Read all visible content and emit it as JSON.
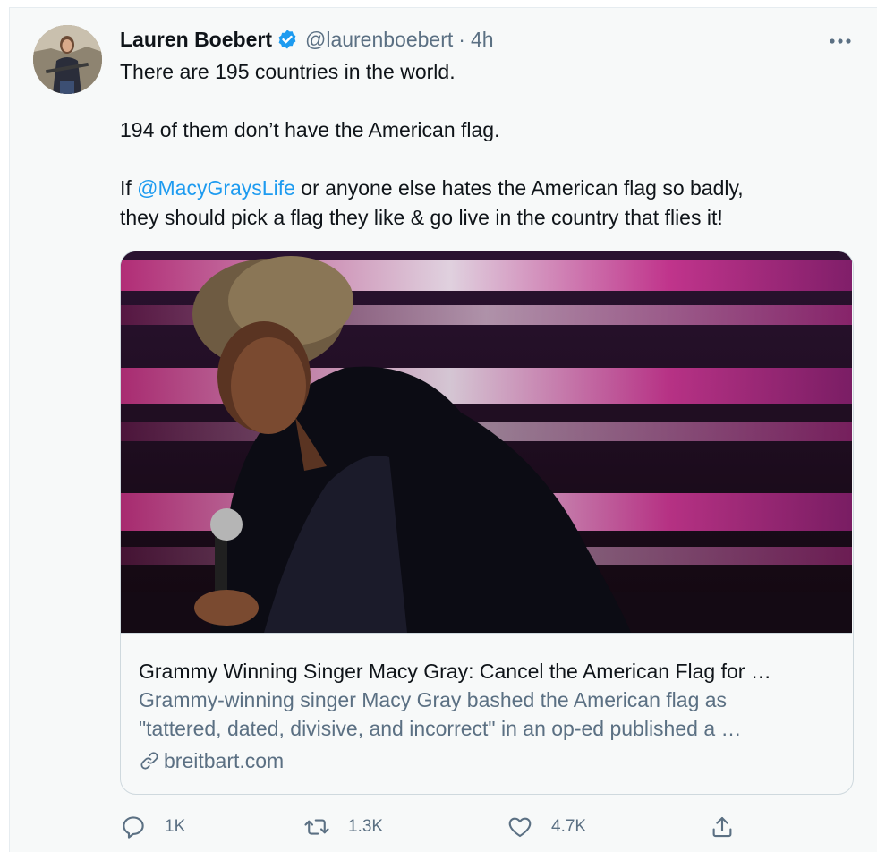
{
  "tweet": {
    "display_name": "Lauren Boebert",
    "handle": "@laurenboebert",
    "separator": "·",
    "time": "4h",
    "lines": [
      {
        "text": "There are 195 countries in the world."
      },
      {
        "text": "194 of them don’t have the American flag."
      },
      {
        "prefix": "If ",
        "mention": "@MacyGraysLife",
        "suffix": " or anyone else hates the American flag so badly,"
      },
      {
        "text": "they should pick a flag they like & go live in the country that flies it!"
      }
    ],
    "icons": {
      "verified": "verified-badge-icon",
      "more": "more-options-icon"
    }
  },
  "card": {
    "title": "Grammy Winning Singer Macy Gray: Cancel the American Flag for …",
    "description_line1": "Grammy-winning singer Macy Gray bashed the American flag as",
    "description_line2": "\"tattered, dated, divisive, and incorrect\" in an op-ed published a …",
    "domain": "breitbart.com",
    "image": "photo of singer holding microphone in front of pink stage lights"
  },
  "actions": {
    "reply_count": "1K",
    "retweet_count": "1.3K",
    "like_count": "4.7K"
  },
  "colors": {
    "accent": "#1d9bf0",
    "secondary_text": "#5b7083",
    "border": "#cfd9de",
    "background": "#f7f9f9"
  }
}
